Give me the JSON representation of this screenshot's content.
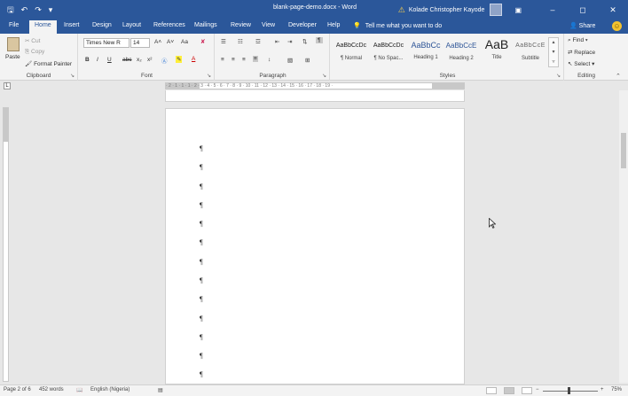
{
  "titlebar": {
    "save_icon": "save-icon",
    "undo_icon": "undo-icon",
    "redo_icon": "redo-icon",
    "customize_icon": "customize-qat-icon",
    "document_title": "blank-page-demo.docx - Word",
    "warning_icon": "warning-icon",
    "user_name": "Kolade Christopher Kayode",
    "ribbon_display_icon": "ribbon-display-options-icon",
    "minimize_glyph": "–",
    "maximize_glyph": "◻",
    "close_glyph": "✕"
  },
  "tabs": [
    {
      "label": "File"
    },
    {
      "label": "Home"
    },
    {
      "label": "Insert"
    },
    {
      "label": "Design"
    },
    {
      "label": "Layout"
    },
    {
      "label": "References"
    },
    {
      "label": "Mailings"
    },
    {
      "label": "Review"
    },
    {
      "label": "View"
    },
    {
      "label": "Developer"
    },
    {
      "label": "Help"
    }
  ],
  "active_tab": "Home",
  "tell_me": {
    "icon": "lightbulb-icon",
    "placeholder": "Tell me what you want to do"
  },
  "share": {
    "label": "Share",
    "icon": "person-icon"
  },
  "ribbon": {
    "clipboard": {
      "label": "Clipboard",
      "paste": "Paste",
      "cut": "Cut",
      "copy": "Copy",
      "format_painter": "Format Painter"
    },
    "font": {
      "label": "Font",
      "font_name": "Times New R",
      "font_size": "14",
      "grow": "A˄",
      "shrink": "A˅",
      "change_case": "Aa",
      "bold": "B",
      "italic": "I",
      "underline": "U",
      "strike": "abc",
      "subscript": "x₂",
      "superscript": "x²"
    },
    "paragraph": {
      "label": "Paragraph",
      "pilcrow": "¶"
    },
    "styles": {
      "label": "Styles",
      "items": [
        {
          "sample": "AaBbCcDc",
          "name": "¶ Normal"
        },
        {
          "sample": "AaBbCcDc",
          "name": "¶ No Spac..."
        },
        {
          "sample": "AaBbCc",
          "name": "Heading 1"
        },
        {
          "sample": "AaBbCcE",
          "name": "Heading 2"
        },
        {
          "sample": "AaB",
          "name": "Title"
        },
        {
          "sample": "AaBbCcE",
          "name": "Subtitle"
        }
      ]
    },
    "editing": {
      "label": "Editing",
      "find": "Find",
      "replace": "Replace",
      "select": "Select"
    }
  },
  "ruler_text": "· 2 · 1 · 1 · 1 · 2 · 3 · 4 · 5 · 6 · 7 · 8 · 9 · 10 · 11 · 12 · 13 · 14 · 15 · 16 · 17 · 18 · 19 ·",
  "document": {
    "pilcrows": [
      "¶",
      "¶",
      "¶",
      "¶",
      "¶",
      "¶",
      "¶",
      "¶",
      "¶",
      "¶",
      "¶",
      "¶",
      "¶"
    ]
  },
  "statusbar": {
    "page": "Page 2 of 6",
    "words": "452 words",
    "language": "English (Nigeria)",
    "zoom": "75%"
  }
}
